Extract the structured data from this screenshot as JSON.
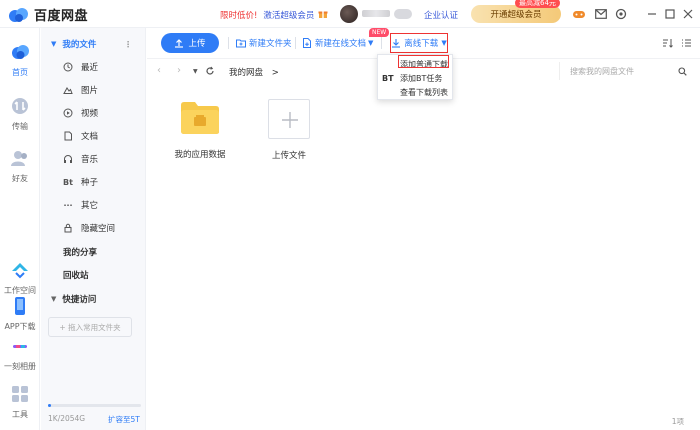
{
  "app": {
    "name": "百度网盘"
  },
  "titlebar": {
    "promo_prefix": "限时低价!",
    "promo_link": "激活超级会员",
    "enterprise": "企业认证",
    "open_vip": "开通超级会员",
    "vip_discount": "最高减64元"
  },
  "rail": {
    "items": [
      {
        "label": "首页",
        "icon": "cloud-home-icon"
      },
      {
        "label": "传输",
        "icon": "transfer-icon"
      },
      {
        "label": "好友",
        "icon": "friends-icon"
      },
      {
        "label": "工作空间",
        "icon": "workspace-icon"
      },
      {
        "label": "APP下载",
        "icon": "phone-icon"
      },
      {
        "label": "一刻相册",
        "icon": "album-icon"
      },
      {
        "label": "工具",
        "icon": "tools-icon"
      }
    ]
  },
  "sidebar": {
    "my_files": "我的文件",
    "items": [
      {
        "label": "最近",
        "icon": "clock-icon"
      },
      {
        "label": "图片",
        "icon": "image-icon"
      },
      {
        "label": "视频",
        "icon": "video-icon"
      },
      {
        "label": "文档",
        "icon": "document-icon"
      },
      {
        "label": "音乐",
        "icon": "music-icon"
      },
      {
        "label": "种子",
        "icon": "bt-icon",
        "glyph": "Bt"
      },
      {
        "label": "其它",
        "icon": "more-icon",
        "glyph": "···"
      },
      {
        "label": "隐藏空间",
        "icon": "lock-icon"
      }
    ],
    "my_share": "我的分享",
    "recycle": "回收站",
    "quick_access": "快捷访问",
    "add_favorite": "+ 拖入常用文件夹",
    "quota": "1K/2054G",
    "quota_fraction": 0.03,
    "expand": "扩容至5T"
  },
  "toolbar": {
    "upload": "上传",
    "new_folder": "新建文件夹",
    "new_online_doc": "新建在线文档",
    "new_badge": "NEW",
    "offline_download": "离线下载"
  },
  "nav": {
    "breadcrumb": "我的网盘",
    "breadcrumb_arrow": ">",
    "search_placeholder": "搜索我的网盘文件"
  },
  "files": [
    {
      "name": "我的应用数据",
      "type": "folder"
    },
    {
      "name": "上传文件",
      "type": "upload"
    }
  ],
  "dropdown": {
    "items": [
      {
        "prefix": "",
        "label": "添加普通下载"
      },
      {
        "prefix": "BT",
        "label": "添加BT任务"
      },
      {
        "prefix": "",
        "label": "查看下载列表"
      }
    ]
  },
  "status": {
    "count": "1项"
  },
  "colors": {
    "accent": "#2f7cf6",
    "highlight": "#ee3333"
  }
}
